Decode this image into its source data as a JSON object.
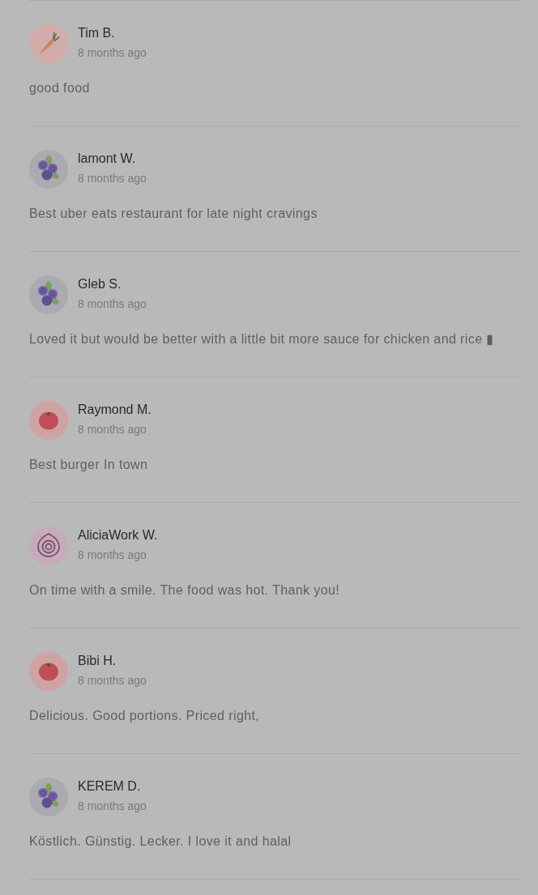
{
  "reviews": [
    {
      "avatar": {
        "kind": "carrot"
      },
      "name": "Tim B.",
      "time": "8 months ago",
      "text": "good food"
    },
    {
      "avatar": {
        "kind": "blueberries"
      },
      "name": "lamont W.",
      "time": "8 months ago",
      "text": "Best uber eats restaurant for late night cravings"
    },
    {
      "avatar": {
        "kind": "blueberries"
      },
      "name": "Gleb S.",
      "time": "8 months ago",
      "text": "Loved it but would be better with a little bit more sauce for chicken and rice ▮"
    },
    {
      "avatar": {
        "kind": "tomato"
      },
      "name": "Raymond M.",
      "time": "8 months ago",
      "text": "Best burger In town"
    },
    {
      "avatar": {
        "kind": "onion"
      },
      "name": "AliciaWork W.",
      "time": "8 months ago",
      "text": "On time with a smile. The food was hot. Thank you!"
    },
    {
      "avatar": {
        "kind": "tomato"
      },
      "name": "Bibi H.",
      "time": "8 months ago",
      "text": "Delicious. Good portions. Priced right,"
    },
    {
      "avatar": {
        "kind": "blueberries"
      },
      "name": "KEREM D.",
      "time": "8 months ago",
      "text": "Köstlich. Günstig. Lecker. I love it and halal"
    }
  ]
}
